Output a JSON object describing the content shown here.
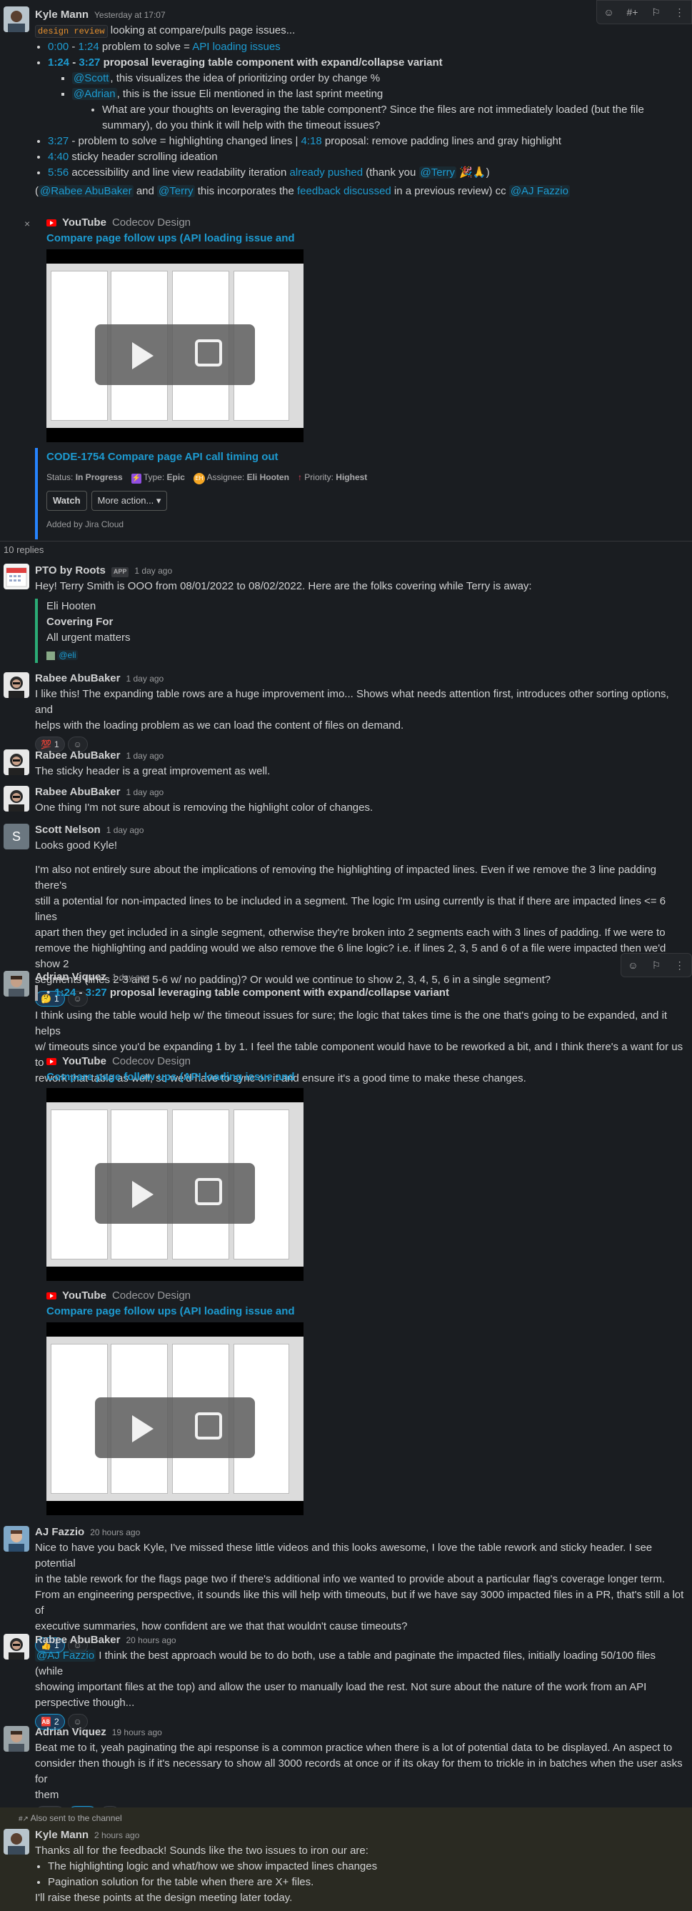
{
  "toolbar_top": {
    "icons": [
      "add-reaction-icon",
      "hashtag-plus-icon",
      "bookmark-icon",
      "more-icon"
    ]
  },
  "m1": {
    "author": "Kyle Mann",
    "time": "Yesterday at 17:07",
    "tag": "design review",
    "intro": " looking at compare/pulls page issues...",
    "b1_t1": "0:00",
    "b1_sep": " - ",
    "b1_t2": "1:24",
    "b1_text": " problem to solve = ",
    "b1_link": "API loading issues",
    "b2_t1": "1:24",
    "b2_sep": " - ",
    "b2_t2": "3:27",
    "b2_text": " proposal leveraging table component with expand/collapse variant",
    "b2a_m": "@Scott",
    "b2a_t": ", this visualizes the idea of prioritizing order by change %",
    "b2b_m": "@Adrian",
    "b2b_t": ", this is the issue Eli mentioned in the last sprint meeting",
    "b2c_1": "What are your thoughts on leveraging the table component? Since the files are not immediately loaded (but the file",
    "b2c_2": "summary), do you think it will help with the timeout issues?",
    "b3_t1": "3:27",
    "b3_t": " - problem to solve = highlighting changed lines | ",
    "b3_t2": "4:18",
    "b3_t3": " proposal: remove padding lines and gray highlight",
    "b4_t1": "4:40",
    "b4_t": " sticky header scrolling ideation",
    "b5_t1": "5:56",
    "b5_t": " accessibility and line view readability iteration ",
    "b5_link": "already pushed",
    "b5_t2": " (thank you ",
    "b5_m": "@Terry",
    "b5_e": " 🎉🙏)",
    "p_open": "(",
    "p_m1": "@Rabee AbuBaker",
    "p_and": " and ",
    "p_m2": "@Terry",
    "p_t": " this incorporates the ",
    "p_link": "feedback discussed",
    "p_t2": " in a previous review) cc ",
    "p_m3": "@AJ Fazzio"
  },
  "yt1": {
    "source": "YouTube",
    "sub": "Codecov Design",
    "title": "Compare page follow ups (API loading issue and related)"
  },
  "jira": {
    "key_title": "CODE-1754 Compare page API call timing out",
    "status_l": "Status: ",
    "status": "In Progress",
    "type_l": "Type: ",
    "type": "Epic",
    "assignee_l": "Assignee: ",
    "assignee": "Eli Hooten",
    "priority_l": "Priority: ",
    "priority": "Highest",
    "watch": "Watch",
    "more": "More action...",
    "added": "Added by Jira Cloud"
  },
  "replies": "10 replies",
  "pto": {
    "author": "PTO by Roots",
    "app": "APP",
    "time": "1 day ago",
    "text": "Hey! Terry Smith is OOO from 08/01/2022 to 08/02/2022. Here are the folks covering while Terry is away:",
    "cover_name": "Eli Hooten",
    "cover_head": "Covering For",
    "cover_what": "All urgent matters",
    "cover_m": "@eli"
  },
  "r1": {
    "author": "Rabee AbuBaker",
    "time": "1 day ago",
    "l1": "I like this! The expanding table rows are a huge improvement imo... Shows what needs attention first, introduces other sorting options, and",
    "l2": "helps with the loading problem as we can load the content of files on demand.",
    "react_e": "💯",
    "react_n": "1"
  },
  "r2": {
    "author": "Rabee AbuBaker",
    "time": "1 day ago",
    "text": "The sticky header is a great improvement as well."
  },
  "r3": {
    "author": "Rabee AbuBaker",
    "time": "1 day ago",
    "text": "One thing I'm not sure about is removing the highlight color of changes."
  },
  "s1": {
    "author": "Scott Nelson",
    "initial": "S",
    "time": "1 day ago",
    "text": "Looks good Kyle!",
    "p1": "I'm also not entirely sure about the implications of removing the highlighting of impacted lines.  Even if we remove the 3 line padding there's",
    "p2": "still a potential for non-impacted lines to be included in a segment.  The logic I'm using currently is that if there are impacted lines <= 6 lines",
    "p3": "apart then they get included in a single segment, otherwise they're broken into 2 segments each with 3 lines of padding.  If we were to",
    "p4": "remove the highlighting and padding would we also remove the 6 line logic? i.e. if lines 2, 3, 5 and 6 of a file were impacted then we'd show 2",
    "p5": "segments (lines 2-3 and 5-6 w/ no padding)?  Or would we continue to show 2, 3, 4, 5, 6 in a single segment?",
    "react_e": "🤔",
    "react_n": "1"
  },
  "a1": {
    "author": "Adrian Viquez",
    "time": "1 day ago",
    "q_t1": "1:24",
    "q_sep": " - ",
    "q_t2": "3:27",
    "q_text": " proposal leveraging table component with expand/collapse variant",
    "l1": "I think using the table would help w/ the timeout issues for sure; the logic that takes time is the one that's going to be expanded, and it helps",
    "l2": "w/ timeouts since you'd be expanding 1 by 1. I feel the table component would have to be reworked a bit, and I think there's a want for us to",
    "l3": "rework that table as well, so we'd have to sync on it and ensure it's a good time to make these changes."
  },
  "yt2": {
    "source": "YouTube",
    "sub": "Codecov Design",
    "title": "Compare page follow ups (API loading issue and related)"
  },
  "yt3": {
    "source": "YouTube",
    "sub": "Codecov Design",
    "title": "Compare page follow ups (API loading issue and related)"
  },
  "aj": {
    "author": "AJ Fazzio",
    "time": "20 hours ago",
    "l1": "Nice to have you back Kyle, I've missed these little videos and this looks awesome, I love the table rework and sticky header. I see potential",
    "l2": "in the table rework for the flags page two if there's additional info we wanted to provide about a particular flag's coverage longer term.",
    "l3": "From an engineering perspective, it sounds like this will help with timeouts, but if we have say 3000 impacted files in a PR, that's still a lot of",
    "l4": "executive summaries, how confident are we that that wouldn't cause timeouts?",
    "react_e": "👍",
    "react_n": "1"
  },
  "r4": {
    "author": "Rabee AbuBaker",
    "time": "20 hours ago",
    "m": "@AJ Fazzio",
    "l1": " I think the best approach would be to do both, use a table and paginate the impacted files, initially loading 50/100 files (while",
    "l2": "showing important files at the top) and allow the user to manually load the rest. Not sure about the nature of the work from an API",
    "l3": "perspective though...",
    "react_e": "🆎",
    "react_n": "2"
  },
  "a2": {
    "author": "Adrian Viquez",
    "time": "19 hours ago",
    "l1": "Beat me to it, yeah paginating the api response is a common practice when there is a lot of potential data to be displayed. An aspect to",
    "l2": "consider then though is if it's necessary to show all 3000 records at once or if its okay for them to trickle in in batches when the user asks for",
    "l3": "them",
    "react1_e": "👍",
    "react1_n": "1",
    "react2_e": "🆎",
    "react2_n": "2"
  },
  "k2": {
    "also": "Also sent to the channel",
    "author": "Kyle Mann",
    "time": "2 hours ago",
    "text": "Thanks all for the feedback! Sounds like the two issues to iron our are:",
    "li1": "The highlighting logic and what/how we show impacted lines changes",
    "li2": "Pagination solution for the table when there are X+ files.",
    "last": "I'll raise these points at the design meeting later today."
  }
}
